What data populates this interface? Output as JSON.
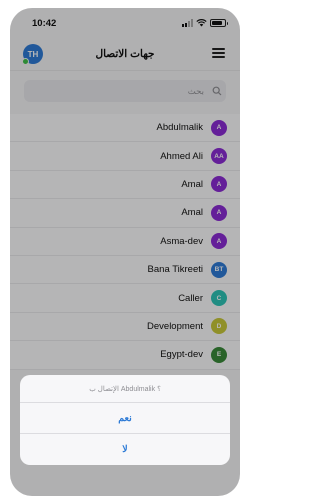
{
  "status_bar": {
    "time": "10:42"
  },
  "header": {
    "title": "جهات الاتصال",
    "avatar_initials": "TH"
  },
  "search": {
    "placeholder": "بحث"
  },
  "contacts": [
    {
      "name": "Abdulmalik",
      "initials": "A",
      "color": "#8b2bd4"
    },
    {
      "name": "Ahmed Ali",
      "initials": "AA",
      "color": "#8b2bd4"
    },
    {
      "name": "Amal",
      "initials": "A",
      "color": "#8b2bd4"
    },
    {
      "name": "Amal",
      "initials": "A",
      "color": "#8b2bd4"
    },
    {
      "name": "Asma-dev",
      "initials": "A",
      "color": "#8b2bd4"
    },
    {
      "name": "Bana Tikreeti",
      "initials": "BT",
      "color": "#2e7bd6"
    },
    {
      "name": "Caller",
      "initials": "C",
      "color": "#2ec4b6"
    },
    {
      "name": "Development",
      "initials": "D",
      "color": "#c8c83a"
    },
    {
      "name": "Egypt-dev",
      "initials": "E",
      "color": "#3a8a3a"
    }
  ],
  "action_sheet": {
    "message": "الإتصال ب Abdulmalik ؟",
    "confirm_label": "نعم",
    "cancel_label": "لا"
  },
  "colors": {
    "accent": "#2e7bd6",
    "online": "#3fbf4a"
  }
}
